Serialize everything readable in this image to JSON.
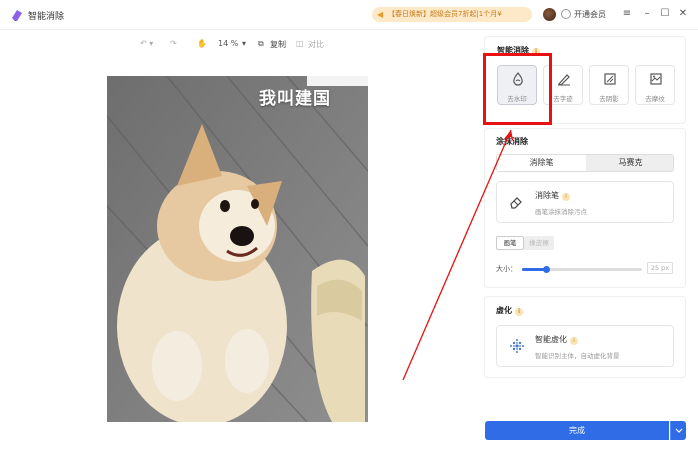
{
  "window": {
    "app_title": "智能消除",
    "promo_text": "【春日焕新】超级会员7折起|1个月¥",
    "vip_label": "开通会员"
  },
  "toolbar": {
    "zoom": "14 %",
    "copy_label": "复制",
    "compare_label": "对比"
  },
  "image": {
    "caption_text": "我叫建国"
  },
  "panel": {
    "smart_remove": {
      "title": "智能消除",
      "tools": [
        {
          "label": "去水印",
          "icon": "watermark-icon",
          "active": true
        },
        {
          "label": "去字迹",
          "icon": "handwriting-icon",
          "active": false
        },
        {
          "label": "去阴影",
          "icon": "shadow-icon",
          "active": false
        },
        {
          "label": "去摩纹",
          "icon": "moire-icon",
          "active": false
        }
      ]
    },
    "smear_remove": {
      "title": "涂抹消除",
      "tab_brush": "消除笔",
      "tab_mosaic": "马赛克",
      "eraser_title": "消除笔",
      "eraser_desc": "画笔涂抹消除污点",
      "mode_brush": "画笔",
      "mode_erase": "橡皮擦",
      "size_label": "大小：",
      "size_value": "25 px",
      "size_fraction": 0.2
    },
    "blur": {
      "title": "虚化",
      "card_title": "智能虚化",
      "card_desc": "智能识别主体，自动虚化背景"
    },
    "done_label": "完成"
  },
  "colors": {
    "accent": "#2f6ce5",
    "annotation": "#e81010"
  }
}
